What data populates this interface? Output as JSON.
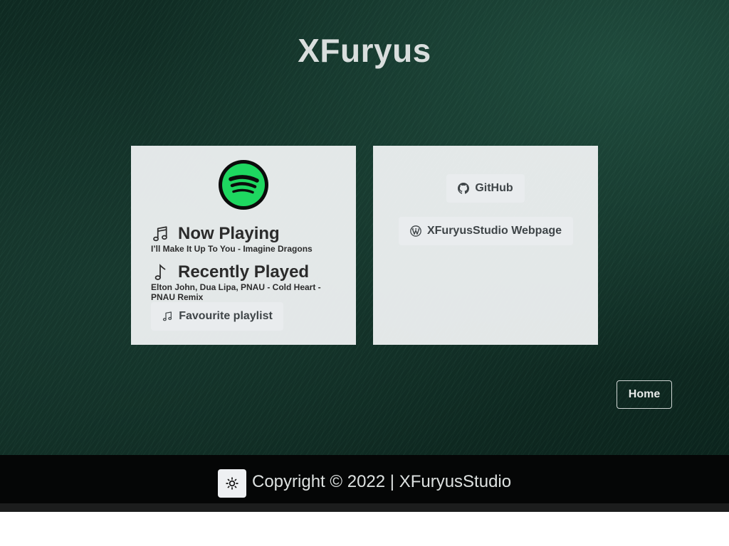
{
  "header": {
    "title": "XFuryus"
  },
  "music_card": {
    "logo_icon": "spotify-icon",
    "now_playing": {
      "heading": "Now Playing",
      "track": "I’ll Make It Up To You - Imagine Dragons",
      "icon": "music-notes-icon"
    },
    "recently_played": {
      "heading": "Recently Played",
      "track": "Elton John, Dua Lipa, PNAU - Cold Heart - PNAU Remix",
      "icon": "music-note-icon"
    },
    "favourite_button": {
      "label": "Favourite playlist",
      "icon": "music-notes-icon"
    }
  },
  "links_card": {
    "github_button": {
      "label": "GitHub",
      "icon": "github-icon"
    },
    "webpage_button": {
      "label": "XFuryusStudio Webpage",
      "icon": "wordpress-icon"
    }
  },
  "nav": {
    "home_label": "Home"
  },
  "footer": {
    "copyright": "Copyright © 2022 | XFuryusStudio",
    "theme_toggle_icon": "sun-icon"
  },
  "colors": {
    "hero_background": "#133128",
    "card_background": "#f3f5f6",
    "spotify_green": "#1ed760",
    "footer_background": "#050606"
  }
}
